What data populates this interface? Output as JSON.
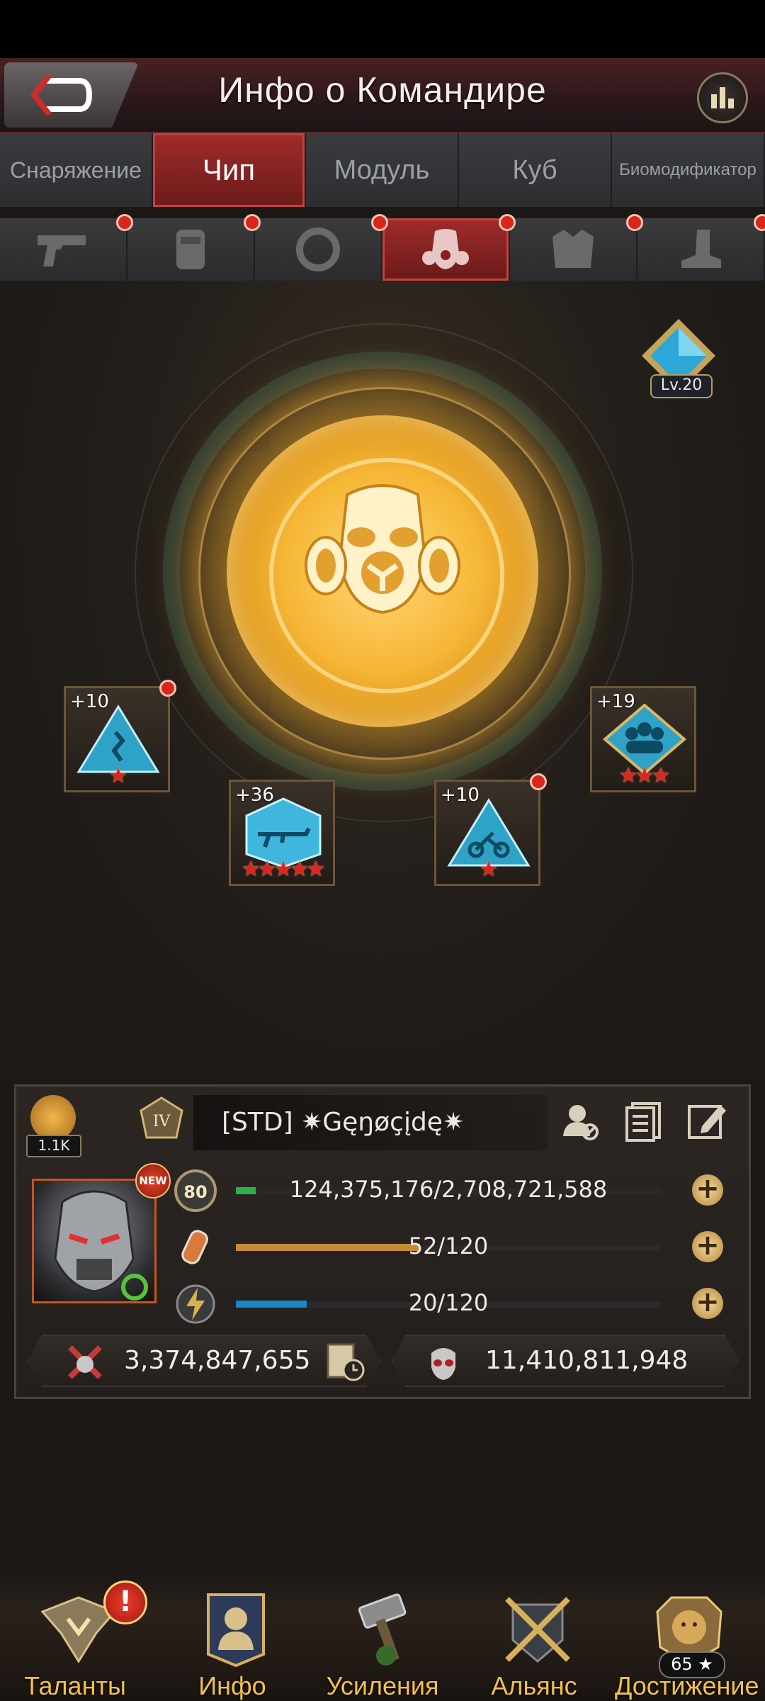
{
  "header": {
    "title": "Инфо о Командире"
  },
  "tabs": [
    {
      "label": "Снаряжение",
      "active": false
    },
    {
      "label": "Чип",
      "active": true
    },
    {
      "label": "Модуль",
      "active": false
    },
    {
      "label": "Куб",
      "active": false
    },
    {
      "label": "Биомодификатор",
      "active": false
    }
  ],
  "slots": [
    {
      "icon": "pistol-icon",
      "has_alert": true,
      "active": false
    },
    {
      "icon": "vest-icon",
      "has_alert": true,
      "active": false
    },
    {
      "icon": "ring-icon",
      "has_alert": true,
      "active": false
    },
    {
      "icon": "gas-mask-icon",
      "has_alert": true,
      "active": true
    },
    {
      "icon": "jacket-icon",
      "has_alert": true,
      "active": false
    },
    {
      "icon": "boot-icon",
      "has_alert": true,
      "active": false
    }
  ],
  "core": {
    "level_label": "Lv.20"
  },
  "chips": [
    {
      "level": "+10",
      "stars": "★",
      "icon": "runner-icon",
      "alert": true
    },
    {
      "level": "+19",
      "stars": "★★★",
      "icon": "squad-icon",
      "alert": false
    },
    {
      "level": "+36",
      "stars": "★★★★★",
      "icon": "rifle-icon",
      "alert": false
    },
    {
      "level": "+10",
      "stars": "★",
      "icon": "motorcycle-icon",
      "alert": true
    }
  ],
  "profile": {
    "likes": "1.1K",
    "rank_badge": "IV",
    "name": "[STD]  ✷Gęŋøçįdę✷",
    "new_badge": "NEW",
    "level": "80",
    "exp_text": "124,375,176/2,708,721,588",
    "exp_fraction": 0.046,
    "stamina_text": "52/120",
    "stamina_fraction": 0.433,
    "energy_text": "20/120",
    "energy_fraction": 0.167,
    "power": "3,374,847,655",
    "kills": "11,410,811,948"
  },
  "nav": [
    {
      "label": "Таланты",
      "alert": "!"
    },
    {
      "label": "Инфо"
    },
    {
      "label": "Усиления"
    },
    {
      "label": "Альянс"
    },
    {
      "label": "Достижение",
      "count": "65 ★"
    }
  ],
  "colors": {
    "accent": "#a02b2b",
    "gold": "#f2c148",
    "alert": "#d8261c"
  }
}
